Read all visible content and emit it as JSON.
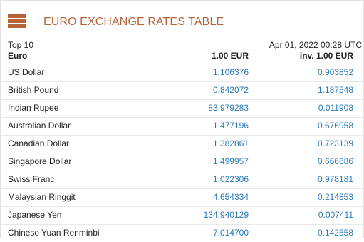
{
  "title": "EURO EXCHANGE RATES TABLE",
  "list_label": "Top 10",
  "timestamp": "Apr 01, 2022 00:28 UTC",
  "colors": {
    "accent": "#b5643a",
    "link": "#2a7ab8",
    "text": "#222222"
  },
  "columns": {
    "currency": "Euro",
    "value": "1.00 EUR",
    "inverse": "inv. 1.00 EUR"
  },
  "rows": [
    {
      "currency": "US Dollar",
      "value": "1.106376",
      "inverse": "0.903852"
    },
    {
      "currency": "British Pound",
      "value": "0.842072",
      "inverse": "1.187548"
    },
    {
      "currency": "Indian Rupee",
      "value": "83.979283",
      "inverse": "0.011908"
    },
    {
      "currency": "Australian Dollar",
      "value": "1.477196",
      "inverse": "0.676958"
    },
    {
      "currency": "Canadian Dollar",
      "value": "1.382861",
      "inverse": "0.723139"
    },
    {
      "currency": "Singapore Dollar",
      "value": "1.499957",
      "inverse": "0.666686"
    },
    {
      "currency": "Swiss Franc",
      "value": "1.022306",
      "inverse": "0.978181"
    },
    {
      "currency": "Malaysian Ringgit",
      "value": "4.654334",
      "inverse": "0.214853"
    },
    {
      "currency": "Japanese Yen",
      "value": "134.940129",
      "inverse": "0.007411"
    },
    {
      "currency": "Chinese Yuan Renminbi",
      "value": "7.014700",
      "inverse": "0.142558"
    }
  ]
}
